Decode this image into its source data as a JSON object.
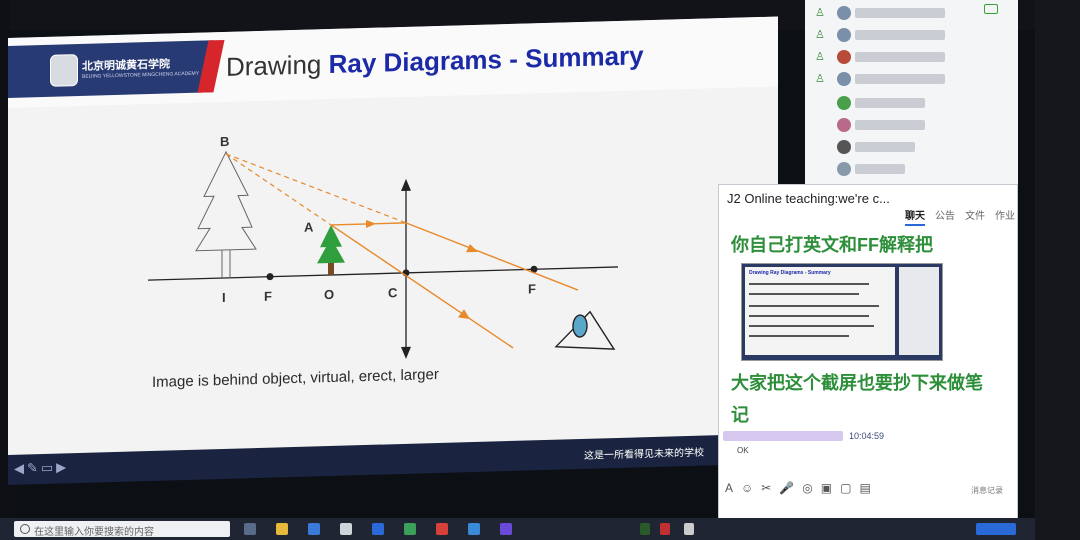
{
  "slide": {
    "title_plain": "Drawing ",
    "title_highlight": "Ray Diagrams - Summary",
    "school_cn": "北京明诚黄石学院",
    "school_en": "BEIJING YELLOWSTONE MINGCHENG ACADEMY",
    "caption": "Image is behind object, virtual, erect, larger",
    "slogan": "这是一所看得见未来的学校",
    "diagram_labels": {
      "B": "B",
      "A": "A",
      "I": "I",
      "F_left": "F",
      "O": "O",
      "C": "C",
      "F_right": "F"
    }
  },
  "chat": {
    "title": "J2 Online teaching:we're  c...",
    "tabs": [
      "聊天",
      "公告",
      "文件",
      "作业"
    ],
    "message1": "你自己打英文和FF解释把",
    "thumb_title": "Drawing Ray Diagrams - Summary",
    "message2_line1": "大家把这个截屏也要抄下来做笔",
    "message2_line2": "记",
    "time": "10:04:59",
    "reply": "OK",
    "history": "消息记录",
    "toolbar_icons": [
      "A",
      "☺",
      "✂",
      "🎤",
      "◎",
      "▣",
      "▢",
      "▤"
    ]
  },
  "taskbar": {
    "search_placeholder": "在这里输入你要搜索的内容"
  },
  "colors": {
    "title_highlight": "#1d2aa8",
    "chat_green": "#2e8f3a",
    "ray": "#e8892b",
    "header_bar": "#283a74"
  }
}
